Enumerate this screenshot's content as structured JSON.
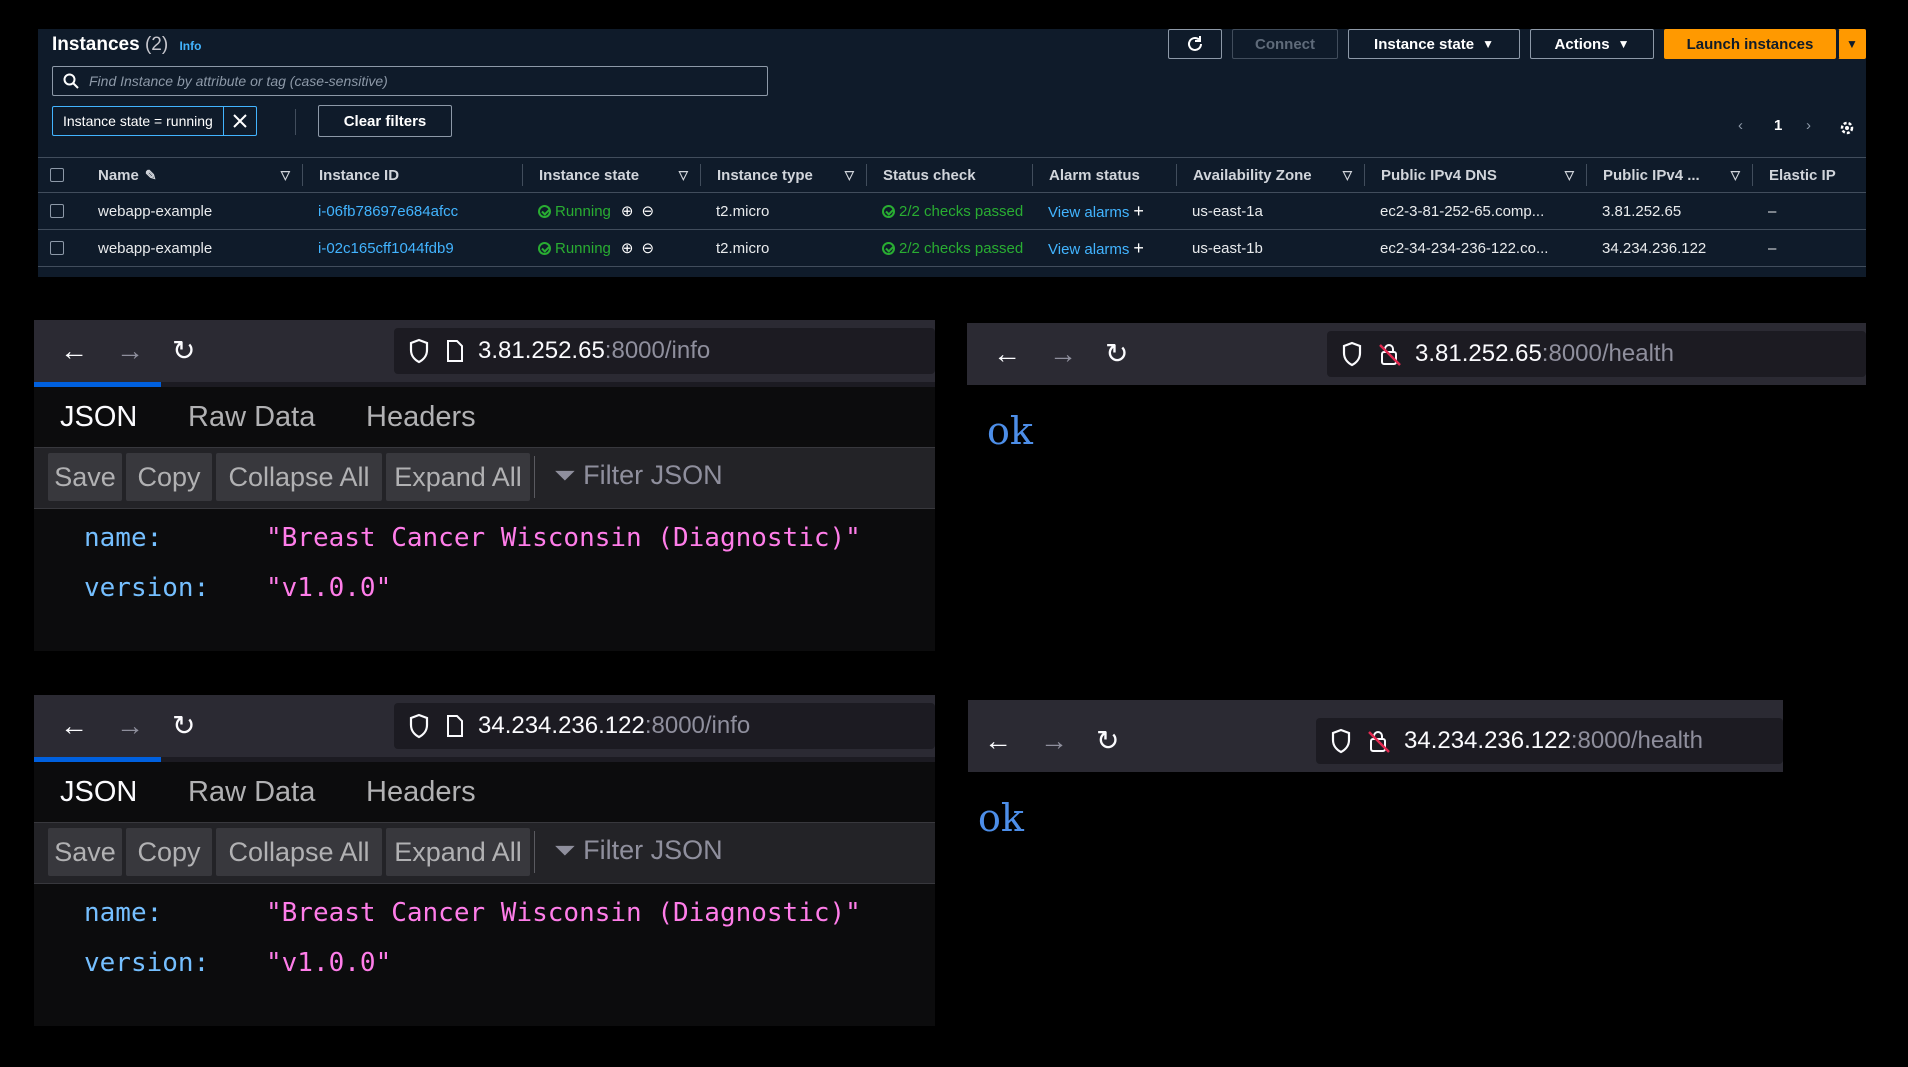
{
  "aws": {
    "title": "Instances",
    "count": "(2)",
    "info": "Info",
    "buttons": {
      "connect": "Connect",
      "instance_state": "Instance state",
      "actions": "Actions",
      "launch": "Launch instances"
    },
    "search_placeholder": "Find Instance by attribute or tag (case-sensitive)",
    "filter_token": "Instance state = running",
    "clear_filters": "Clear filters",
    "page": "1",
    "columns": [
      "Name",
      "Instance ID",
      "Instance state",
      "Instance type",
      "Status check",
      "Alarm status",
      "Availability Zone",
      "Public IPv4 DNS",
      "Public IPv4 ...",
      "Elastic IP"
    ],
    "rows": [
      {
        "name": "webapp-example",
        "id": "i-06fb78697e684afcc",
        "state": "Running",
        "type": "t2.micro",
        "status": "2/2 checks passed",
        "alarm": "View alarms",
        "az": "us-east-1a",
        "dns": "ec2-3-81-252-65.comp...",
        "ipv4": "3.81.252.65",
        "eip": "–"
      },
      {
        "name": "webapp-example",
        "id": "i-02c165cff1044fdb9",
        "state": "Running",
        "type": "t2.micro",
        "status": "2/2 checks passed",
        "alarm": "View alarms",
        "az": "us-east-1b",
        "dns": "ec2-34-234-236-122.co...",
        "ipv4": "34.234.236.122",
        "eip": "–"
      }
    ]
  },
  "browsers": {
    "info1": {
      "host": "3.81.252.65",
      "path": ":8000/info"
    },
    "health1": {
      "host": "3.81.252.65",
      "path": ":8000/health",
      "body": "ok"
    },
    "info2": {
      "host": "34.234.236.122",
      "path": ":8000/info"
    },
    "health2": {
      "host": "34.234.236.122",
      "path": ":8000/health",
      "body": "ok"
    }
  },
  "json_viewer": {
    "tabs": [
      "JSON",
      "Raw Data",
      "Headers"
    ],
    "toolbar": [
      "Save",
      "Copy",
      "Collapse All",
      "Expand All"
    ],
    "filter_placeholder": "Filter JSON",
    "entries": [
      {
        "key": "name:",
        "value": "\"Breast Cancer Wisconsin (Diagnostic)\""
      },
      {
        "key": "version:",
        "value": "\"v1.0.0\""
      }
    ]
  },
  "colors": {
    "aws_bg": "#0f1b2a",
    "aws_orange": "#ff9900",
    "link_blue": "#42b4ff",
    "status_green": "#29ad32",
    "json_key": "#75bfff",
    "json_value": "#ff7de9"
  }
}
